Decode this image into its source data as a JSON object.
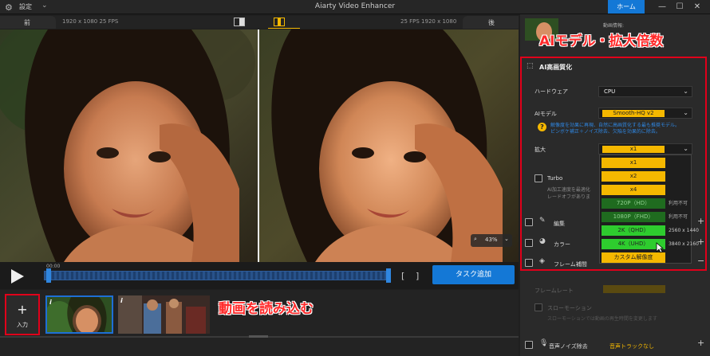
{
  "window": {
    "title": "Aiarty Video Enhancer",
    "settings_label": "設定",
    "home_label": "ホーム"
  },
  "viewer": {
    "before_label": "前",
    "after_label": "後",
    "before_info": "1920 x 1080  25 FPS",
    "after_info": "25 FPS   1920 x 1080",
    "zoom": "43%"
  },
  "timeline": {
    "time": "00:00",
    "add_task_label": "タスク追加"
  },
  "strip": {
    "input_label": "入力",
    "annotation": "動画を読み込む",
    "thumb_marker": "i"
  },
  "panel": {
    "info_label": "動画情報:",
    "annotation": "AIモデル・拡大倍数",
    "section_title": "AI高画質化",
    "hardware_label": "ハードウェア",
    "hardware_value": "CPU",
    "model_label": "AIモデル",
    "model_value": "Smooth-HQ  v2",
    "model_desc_1": "解像度を効果に再現、自然に高画質化する最も推奨モデル。",
    "model_desc_2": "ピンボケ補正＋ノイズ除去、欠陥を効果的に除去。",
    "upscale_label": "拡大",
    "upscale_value": "x1",
    "turbo_label": "Turbo",
    "turbo_desc_1": "AI加工速度を最適化",
    "turbo_desc_2": "レードオフがありま",
    "edit_label": "編集",
    "color_label": "カラー",
    "color_res_1": "2560 x 1440",
    "color_res_2": "3840 x 2160",
    "frame_label": "フレーム補間",
    "frame_rate_label": "フレームレート",
    "slowmo_label": "スローモーション",
    "slowmo_desc": "スローモーションでは動画の再生時間を変更します",
    "noise_label": "音声ノイズ除去",
    "noise_value": "音声トラックなし"
  },
  "dropdown": {
    "options": [
      {
        "label": "x1",
        "state": "available"
      },
      {
        "label": "x2",
        "state": "available"
      },
      {
        "label": "x4",
        "state": "available"
      },
      {
        "label": "720P（HD）",
        "state": "unavailable",
        "note": "利用不可"
      },
      {
        "label": "1080P（FHD）",
        "state": "unavailable",
        "note": "利用不可"
      },
      {
        "label": "2K（QHD）",
        "state": "available-green"
      },
      {
        "label": "4K（UHD）",
        "state": "available-green"
      },
      {
        "label": "カスタム解像度",
        "state": "available"
      }
    ]
  },
  "colors": {
    "accent": "#1478d6",
    "highlight_red": "#e0001a",
    "selector_yellow": "#f5b800"
  }
}
